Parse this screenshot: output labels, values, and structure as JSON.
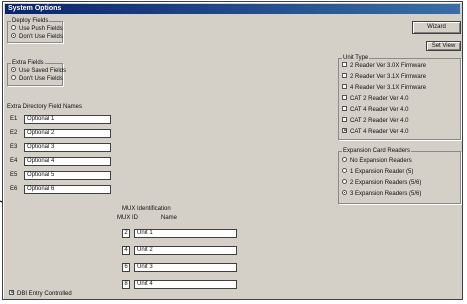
{
  "dialog": {
    "title": "System Options"
  },
  "buttons": {
    "wizard": "Wizard",
    "set_view": "Set View"
  },
  "deploy_fields": {
    "label": "Deploy Fields",
    "options": [
      {
        "label": "Use Push Fields",
        "selected": false
      },
      {
        "label": "Don't Use Fields",
        "selected": true
      }
    ]
  },
  "extra_fields": {
    "label": "Extra Fields",
    "options": [
      {
        "label": "Use Saved Fields",
        "selected": true
      },
      {
        "label": "Don't Use Fields",
        "selected": false
      }
    ]
  },
  "extra_directory": {
    "label": "Extra Directory Field Names",
    "fields": [
      {
        "label": "E1",
        "value": "Optional 1"
      },
      {
        "label": "E2",
        "value": "Optional 2"
      },
      {
        "label": "E3",
        "value": "Optional 3"
      },
      {
        "label": "E4",
        "value": "Optional 4"
      },
      {
        "label": "E5",
        "value": "Optional 5"
      },
      {
        "label": "E6",
        "value": "Optional 6"
      }
    ]
  },
  "unit_type": {
    "label": "Unit Type",
    "options": [
      {
        "label": "2 Reader Ver 3.0X Firmware",
        "checked": false
      },
      {
        "label": "2 Reader Ver 3.1X Firmware",
        "checked": false
      },
      {
        "label": "4 Reader Ver 3.1X Firmware",
        "checked": false
      },
      {
        "label": "CAT 2 Reader Ver 4.0",
        "checked": false
      },
      {
        "label": "CAT 4 Reader Ver 4.0",
        "checked": false
      },
      {
        "label": "CAT 2 Reader Ver 4.0",
        "checked": false
      },
      {
        "label": "CAT 4 Reader Ver 4.0",
        "checked": true
      }
    ]
  },
  "expansion": {
    "label": "Expansion Card Readers",
    "options": [
      {
        "label": "No Expansion Readers",
        "selected": false
      },
      {
        "label": "1 Expansion Reader (5)",
        "selected": false
      },
      {
        "label": "2 Expansion Readers (5/6)",
        "selected": false
      },
      {
        "label": "3 Expansion Readers (5/6)",
        "selected": true
      }
    ]
  },
  "mux_ident": {
    "label": "MUX Identification",
    "col_id": "MUX ID",
    "col_name": "Name",
    "rows": [
      {
        "id": "2",
        "name": "Unit 1"
      },
      {
        "id": "4",
        "name": "Unit 2"
      },
      {
        "id": "6",
        "name": "Unit 3"
      },
      {
        "id": "8",
        "name": "Unit 4"
      }
    ]
  },
  "footer": {
    "dbi_label": "DBI Entry Controlled",
    "dbi_checked": true
  }
}
